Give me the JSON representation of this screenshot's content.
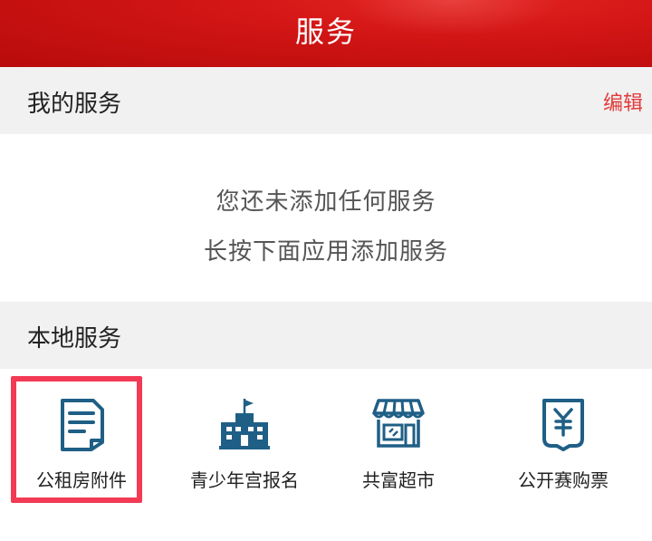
{
  "header": {
    "title": "服务"
  },
  "my_services": {
    "title": "我的服务",
    "edit_label": "编辑",
    "empty_line1": "您还未添加任何服务",
    "empty_line2": "长按下面应用添加服务"
  },
  "local_services": {
    "title": "本地服务",
    "items": [
      {
        "label": "公租房附件",
        "icon": "document-icon"
      },
      {
        "label": "青少年宫报名",
        "icon": "building-flag-icon"
      },
      {
        "label": "共富超市",
        "icon": "store-icon"
      },
      {
        "label": "公开赛购票",
        "icon": "yen-receipt-icon"
      }
    ]
  },
  "colors": {
    "header_red": "#c80f0f",
    "icon_blue": "#1f5f86",
    "edit_red": "#e23a3a",
    "highlight": "#f23a55"
  }
}
